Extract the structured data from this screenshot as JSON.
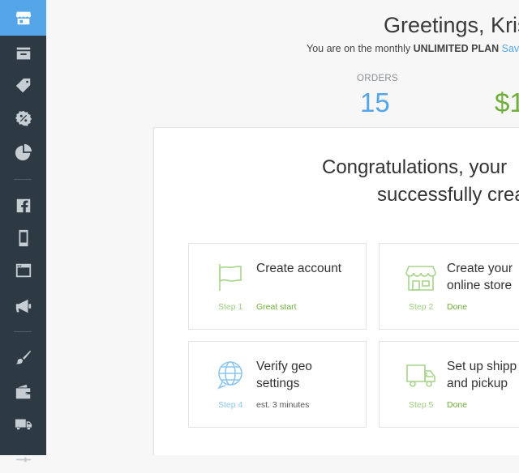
{
  "header": {
    "greeting": "Greetings, Krist",
    "plan_prefix": "You are on the monthly",
    "plan_name": "UNLIMITED PLAN",
    "plan_link": "Sav"
  },
  "stats": {
    "orders_label": "ORDERS",
    "orders_value": "15",
    "revenue_value": "$1"
  },
  "congrats": {
    "line1": "Congratulations, your",
    "line2": "successfully crea"
  },
  "steps": [
    {
      "title1": "Create account",
      "title2": "",
      "num": "Step 1",
      "status": "Great start"
    },
    {
      "title1": "Create your",
      "title2": "online store",
      "num": "Step 2",
      "status": "Done"
    },
    {
      "title1": "Verify geo",
      "title2": "settings",
      "num": "Step 4",
      "status": "est. 3 minutes"
    },
    {
      "title1": "Set up shipp",
      "title2": "and pickup",
      "num": "Step 5",
      "status": "Done"
    }
  ],
  "colors": {
    "sidebar": "#2d3a43",
    "active": "#55a6e8",
    "green": "#6fae3a",
    "blue": "#55a6e8"
  },
  "sidebar_icons": [
    "store-icon",
    "inbox-icon",
    "tag-icon",
    "discount-icon",
    "pie-chart-icon",
    "facebook-icon",
    "mobile-icon",
    "browser-icon",
    "megaphone-icon",
    "brush-icon",
    "wallet-icon",
    "truck-icon",
    "sliders-icon"
  ]
}
